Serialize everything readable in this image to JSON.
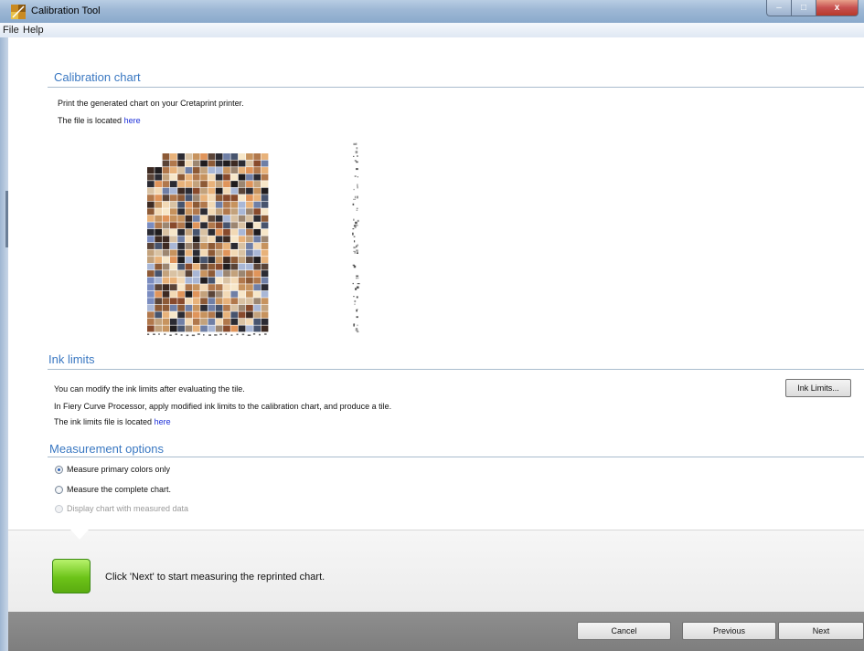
{
  "window": {
    "title": "Calibration Tool",
    "minimize": "–",
    "maximize": "□",
    "close": "x"
  },
  "menu": {
    "file": "File",
    "help": "Help"
  },
  "calibration": {
    "title": "Calibration chart",
    "line1": "Print the generated chart on your Cretaprint printer.",
    "line2": "The file is located",
    "link": "here"
  },
  "ink": {
    "title": "Ink limits",
    "line1": "You can modify the ink limits after evaluating the tile.",
    "line2": "In Fiery Curve Processor, apply modified ink limits to the calibration chart, and produce a tile.",
    "line3": "The ink limits file is located",
    "link": "here",
    "button": "Ink Limits..."
  },
  "measurement": {
    "title": "Measurement options",
    "options": [
      {
        "label": "Measure primary colors only",
        "selected": true,
        "enabled": true
      },
      {
        "label": "Measure the complete chart.",
        "selected": false,
        "enabled": true
      },
      {
        "label": "Display chart with measured data",
        "selected": false,
        "enabled": false
      }
    ]
  },
  "status": {
    "message": "Click 'Next' to start measuring the reprinted chart.",
    "indicator_color": "#6cc318"
  },
  "buttons": {
    "cancel": "Cancel",
    "previous": "Previous",
    "next": "Next"
  },
  "colors": {
    "accent": "#3a78c2",
    "link": "#1c2fd8"
  }
}
